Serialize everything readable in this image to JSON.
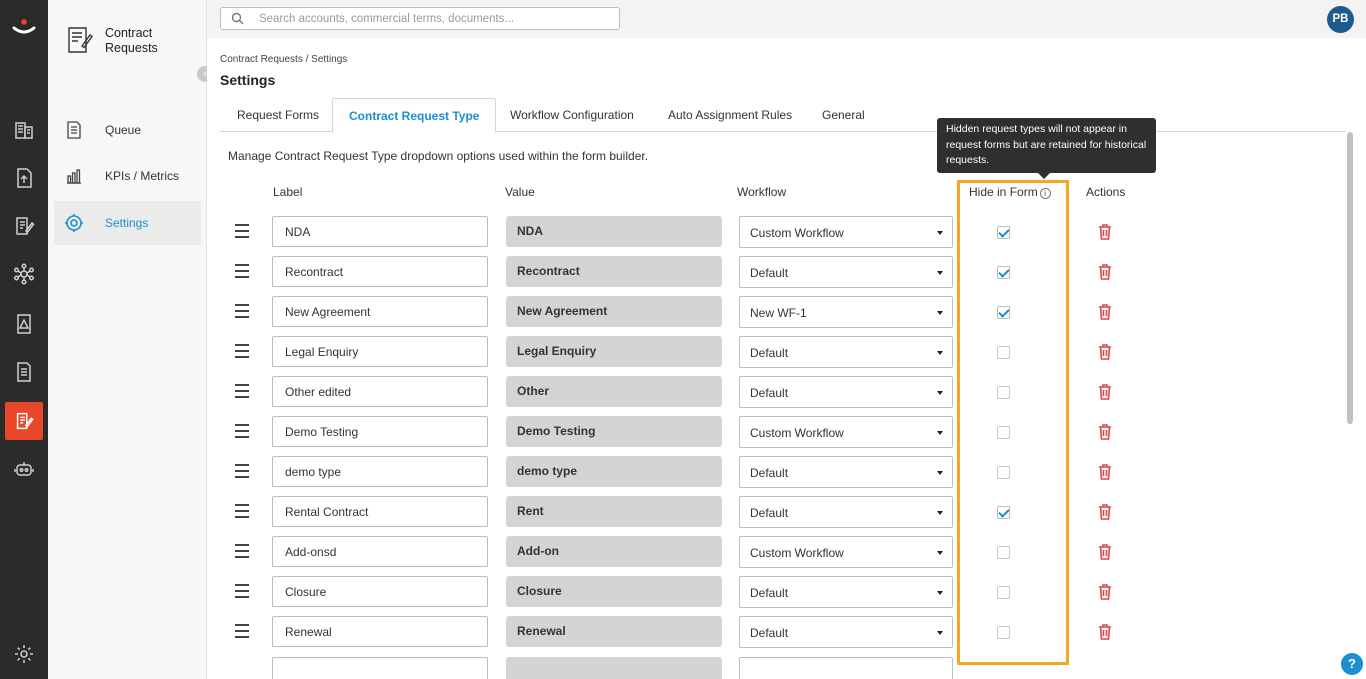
{
  "app": {
    "module_title": "Contract Requests",
    "colors": {
      "accent": "#1a8fd1",
      "brand": "#e8472a",
      "highlight": "#f5a623",
      "danger": "#e0474c"
    }
  },
  "rail": {
    "icons": [
      "logo-icon",
      "buildings-icon",
      "upload-document-icon",
      "edit-document-icon",
      "network-icon",
      "warning-document-icon",
      "document-list-icon",
      "contract-requests-icon",
      "robot-icon",
      "settings-gear-icon"
    ]
  },
  "sidebar": {
    "items": [
      {
        "label": "Queue",
        "icon": "queue-document-icon"
      },
      {
        "label": "KPIs / Metrics",
        "icon": "metrics-icon"
      },
      {
        "label": "Settings",
        "icon": "settings-gear-icon"
      }
    ]
  },
  "search": {
    "placeholder": "Search accounts, commercial terms, documents..."
  },
  "user": {
    "initials": "PB"
  },
  "breadcrumb": "Contract Requests / Settings",
  "page_title": "Settings",
  "tabs": [
    "Request Forms",
    "Contract Request Type",
    "Workflow Configuration",
    "Auto Assignment Rules",
    "General"
  ],
  "active_tab": "Contract Request Type",
  "description": "Manage Contract Request Type dropdown options used within the form builder.",
  "columns": {
    "label": "Label",
    "value": "Value",
    "workflow": "Workflow",
    "hide": "Hide in Form",
    "actions": "Actions"
  },
  "tooltip": "Hidden request types will not appear in request forms but are retained for historical requests.",
  "rows": [
    {
      "label": "NDA",
      "value": "NDA",
      "workflow": "Custom Workflow",
      "hidden": true
    },
    {
      "label": "Recontract",
      "value": "Recontract",
      "workflow": "Default",
      "hidden": true
    },
    {
      "label": "New Agreement",
      "value": "New Agreement",
      "workflow": "New WF-1",
      "hidden": true
    },
    {
      "label": "Legal Enquiry",
      "value": "Legal Enquiry",
      "workflow": "Default",
      "hidden": false
    },
    {
      "label": "Other edited",
      "value": "Other",
      "workflow": "Default",
      "hidden": false
    },
    {
      "label": "Demo Testing",
      "value": "Demo Testing",
      "workflow": "Custom Workflow",
      "hidden": false
    },
    {
      "label": "demo type",
      "value": "demo type",
      "workflow": "Default",
      "hidden": false
    },
    {
      "label": "Rental Contract",
      "value": "Rent",
      "workflow": "Default",
      "hidden": true
    },
    {
      "label": "Add-onsd",
      "value": "Add-on",
      "workflow": "Custom Workflow",
      "hidden": false
    },
    {
      "label": "Closure",
      "value": "Closure",
      "workflow": "Default",
      "hidden": false
    },
    {
      "label": "Renewal",
      "value": "Renewal",
      "workflow": "Default",
      "hidden": false
    }
  ],
  "help": {
    "label": "?"
  }
}
